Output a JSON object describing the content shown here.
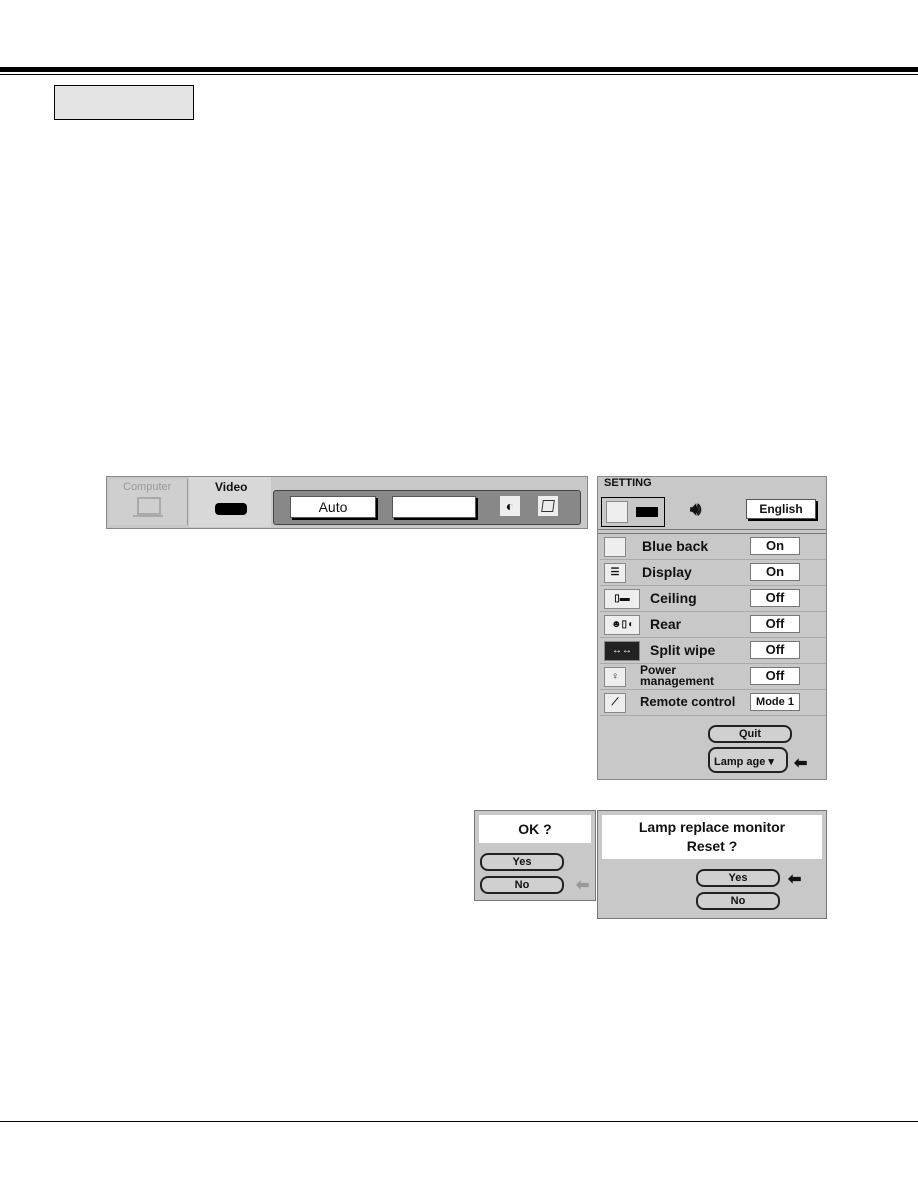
{
  "source_menu": {
    "tabs": [
      {
        "label": "Computer",
        "icon": "computer-icon",
        "active": false
      },
      {
        "label": "Video",
        "icon": "video-player-icon",
        "active": true
      }
    ],
    "mode_value": "Auto",
    "second_value": "",
    "icons": [
      "contrast-icon",
      "keystone-icon"
    ]
  },
  "setting_menu": {
    "title": "SETTING",
    "language": "English",
    "rows": [
      {
        "label": "Blue back",
        "value": "On",
        "icon": "blue-back-icon"
      },
      {
        "label": "Display",
        "value": "On",
        "icon": "display-icon"
      },
      {
        "label": "Ceiling",
        "value": "Off",
        "icon": "ceiling-icon"
      },
      {
        "label": "Rear",
        "value": "Off",
        "icon": "rear-icon"
      },
      {
        "label": "Split wipe",
        "value": "Off",
        "icon": "split-wipe-icon"
      },
      {
        "label": "Power management",
        "value": "Off",
        "icon": "power-management-icon"
      },
      {
        "label": "Remote control",
        "value": "Mode 1",
        "icon": "remote-control-icon"
      }
    ],
    "quit_label": "Quit",
    "lamp_age_label": "Lamp age"
  },
  "ok_dialog": {
    "message": "OK ?",
    "yes": "Yes",
    "no": "No"
  },
  "reset_dialog": {
    "line1": "Lamp replace monitor",
    "line2": "Reset ?",
    "yes": "Yes",
    "no": "No"
  }
}
